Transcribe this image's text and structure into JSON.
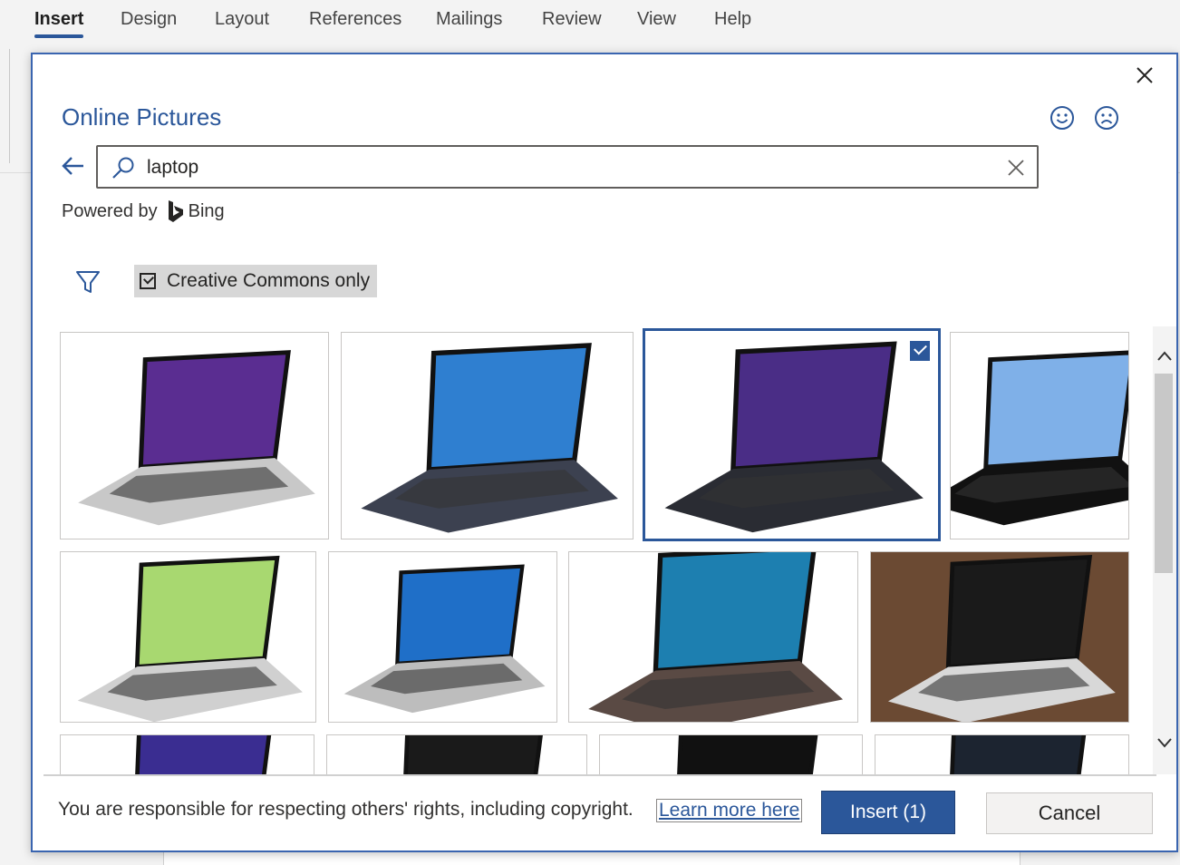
{
  "ribbon": {
    "tabs": [
      {
        "label": "Insert",
        "active": true
      },
      {
        "label": "Design"
      },
      {
        "label": "Layout"
      },
      {
        "label": "References"
      },
      {
        "label": "Mailings"
      },
      {
        "label": "Review"
      },
      {
        "label": "View"
      },
      {
        "label": "Help"
      }
    ]
  },
  "dialog": {
    "title": "Online Pictures",
    "close_icon": "close-icon",
    "feedback": {
      "smile_icon": "smile-icon",
      "frown_icon": "frown-icon"
    },
    "search": {
      "value": "laptop",
      "placeholder": ""
    },
    "powered_by": {
      "prefix": "Powered by",
      "brand": "Bing"
    },
    "filter": {
      "icon": "filter-icon",
      "creative_commons_label": "Creative Commons only",
      "creative_commons_checked": true
    },
    "results": [
      {
        "alt": "laptop-1",
        "screen": "#5a2d91",
        "body": "#c8c8c8",
        "selected": false
      },
      {
        "alt": "laptop-2",
        "screen": "#2f7fd0",
        "body": "#3c4150",
        "selected": false
      },
      {
        "alt": "laptop-3",
        "screen": "#4a2d86",
        "body": "#2a2c33",
        "selected": true
      },
      {
        "alt": "laptop-4",
        "screen": "#7fb0e8",
        "body": "#111111",
        "selected": false
      },
      {
        "alt": "laptop-5",
        "screen": "#a8d870",
        "body": "#d0d0d0",
        "selected": false
      },
      {
        "alt": "laptop-6",
        "screen": "#1f6fc8",
        "body": "#bdbdbd",
        "selected": false
      },
      {
        "alt": "laptop-7",
        "screen": "#1d7fb0",
        "body": "#5a4a44",
        "selected": false
      },
      {
        "alt": "laptop-8",
        "screen": "#1a1a1a",
        "body": "#d8d8d8",
        "selected": false
      },
      {
        "alt": "laptop-9",
        "screen": "#3a2d91",
        "body": "#2a2a2a",
        "selected": false
      },
      {
        "alt": "laptop-10",
        "screen": "#1a1a1a",
        "body": "#222222",
        "selected": false
      },
      {
        "alt": "laptop-11",
        "screen": "#111111",
        "body": "#222222",
        "selected": false
      },
      {
        "alt": "laptop-12",
        "screen": "#1c2430",
        "body": "#222222",
        "selected": false
      }
    ],
    "footer": {
      "notice": "You are responsible for respecting others' rights, including copyright.",
      "learn_more": "Learn more here",
      "insert_label": "Insert (1)",
      "cancel_label": "Cancel"
    }
  },
  "colors": {
    "accent": "#2b579a",
    "dialog_border": "#3a65b0"
  }
}
